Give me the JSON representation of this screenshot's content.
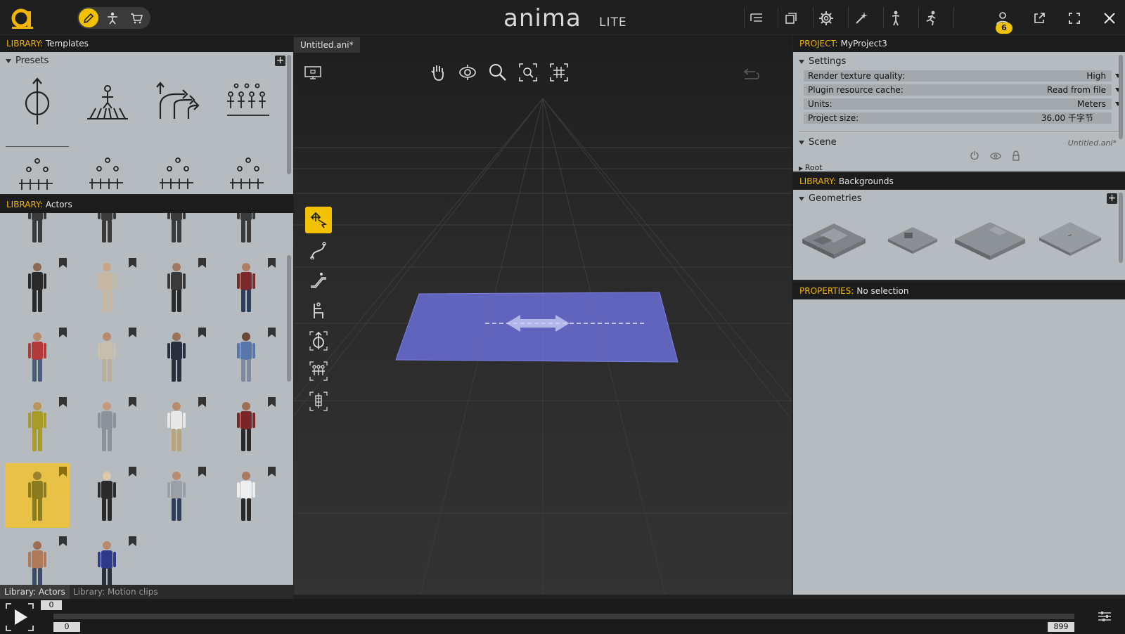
{
  "brand": {
    "name": "anima",
    "edition": "LITE"
  },
  "topbar": {
    "notification_count": "6"
  },
  "left": {
    "templates_header": {
      "key": "LIBRARY:",
      "value": "Templates"
    },
    "presets_title": "Presets",
    "actors_header": {
      "key": "LIBRARY:",
      "value": "Actors"
    },
    "tabs": [
      "Library: Actors",
      "Library: Motion clips"
    ]
  },
  "viewport": {
    "doc_tab": "Untitled.ani*"
  },
  "right": {
    "project_header": {
      "key": "PROJECT:",
      "value": "MyProject3"
    },
    "settings_title": "Settings",
    "settings": [
      {
        "label": "Render texture quality:",
        "value": "High"
      },
      {
        "label": "Plugin resource cache:",
        "value": "Read from file"
      },
      {
        "label": "Units:",
        "value": "Meters"
      },
      {
        "label": "Project size:",
        "value": "36.00 千字节"
      }
    ],
    "scene_title": "Scene",
    "scene_file": "Untitled.ani*",
    "scene_root": "Root",
    "backgrounds_header": {
      "key": "LIBRARY:",
      "value": "Backgrounds"
    },
    "geometries_title": "Geometries",
    "properties_header": {
      "key": "PROPERTIES:",
      "value": "No selection"
    }
  },
  "timeline": {
    "current_frame": "0",
    "start_frame": "0",
    "end_frame": "899"
  },
  "colors": {
    "accent": "#f2c200",
    "panel": "#b6bbbf",
    "path_plane": "#6b6fd6"
  }
}
